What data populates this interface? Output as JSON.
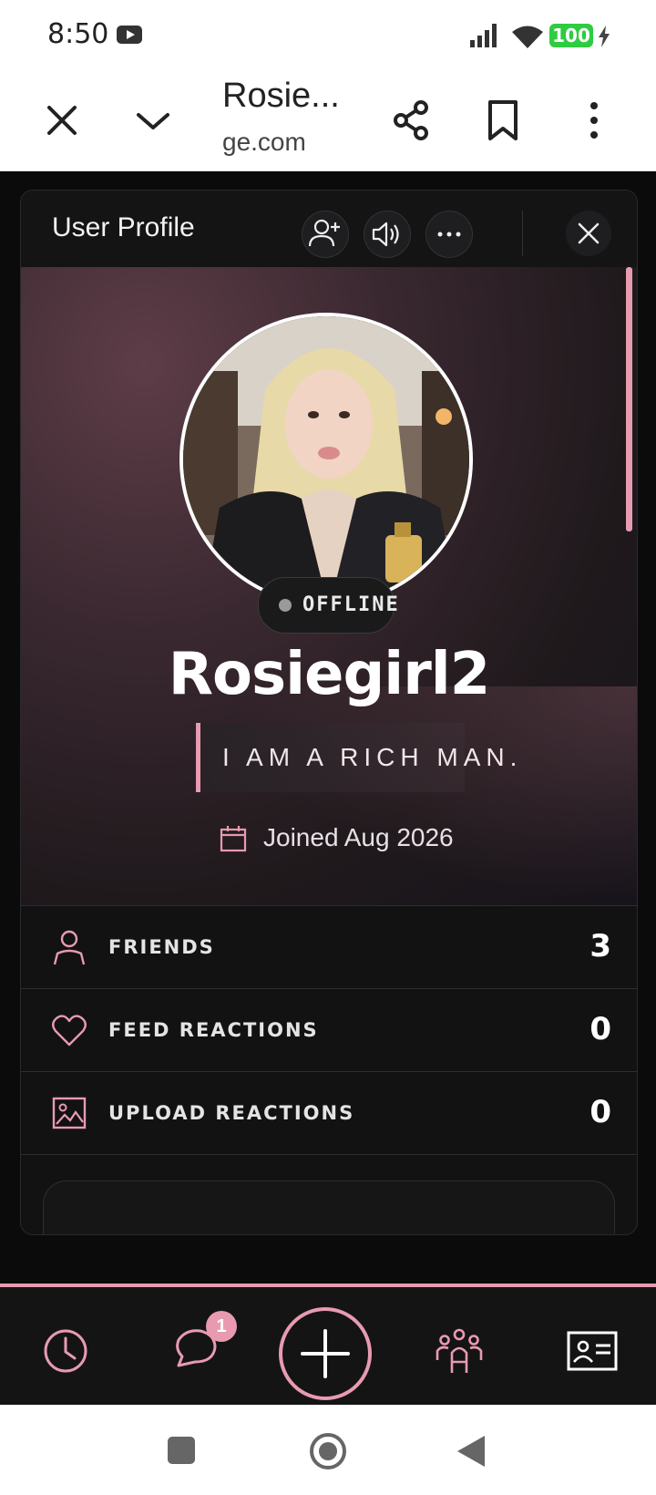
{
  "status_bar": {
    "time": "8:50",
    "battery": "100"
  },
  "browser": {
    "title": "Rosie...",
    "url": "ge.com"
  },
  "modal": {
    "title": "User Profile"
  },
  "profile": {
    "status": "OFFLINE",
    "username": "Rosiegirl2",
    "bio": "I AM A RICH MAN.",
    "joined": "Joined Aug 2026"
  },
  "stats": [
    {
      "label": "FRIENDS",
      "value": "3",
      "icon": "person-icon"
    },
    {
      "label": "FEED REACTIONS",
      "value": "0",
      "icon": "heart-icon"
    },
    {
      "label": "UPLOAD REACTIONS",
      "value": "0",
      "icon": "image-icon"
    }
  ],
  "bottom_nav": {
    "messages_badge": "1"
  },
  "colors": {
    "accent": "#e89bb0",
    "background": "#0b0b0c",
    "panel": "#121213"
  }
}
